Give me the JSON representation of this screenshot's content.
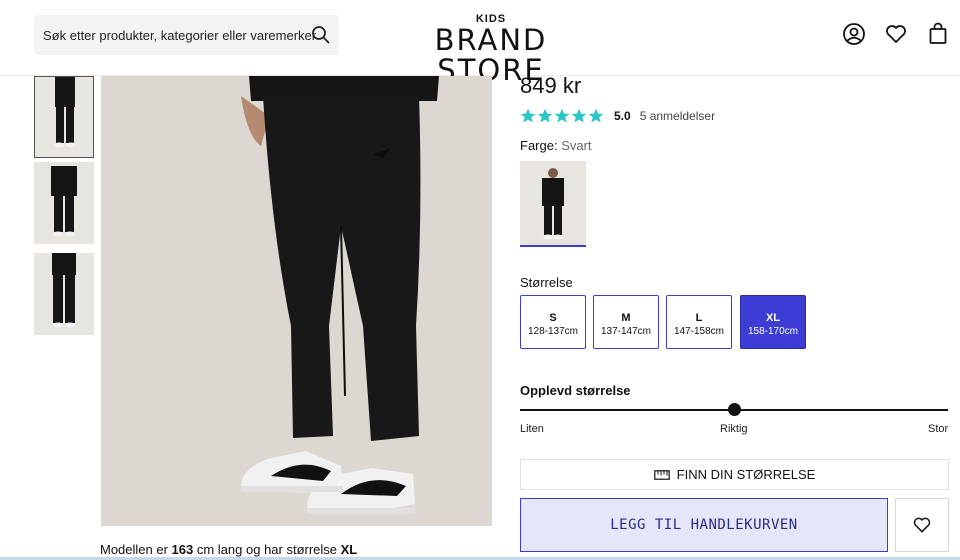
{
  "header": {
    "search_placeholder": "Søk etter produkter, kategorier eller varemerker",
    "logo_top": "KIDS",
    "logo_main": "BRAND STORE",
    "icons": [
      "account-icon",
      "wishlist-icon",
      "cart-icon"
    ]
  },
  "gallery": {
    "thumbnails": [
      "thumbnail-front",
      "thumbnail-full-outfit",
      "thumbnail-back"
    ],
    "selected_index": 0,
    "model_info": {
      "prefix": "Modellen er ",
      "height": "163",
      "middle": " cm lang og har størrelse ",
      "size": "XL"
    }
  },
  "product": {
    "price": "849 kr",
    "rating": {
      "value": "5.0",
      "stars": 5,
      "count_label": "5 anmeldelser",
      "star_color": "#2cc5c5"
    },
    "color_label": "Farge:",
    "color_value": "Svart",
    "size_label": "Størrelse",
    "sizes": [
      {
        "name": "S",
        "range": "128-137cm",
        "selected": false
      },
      {
        "name": "M",
        "range": "137-147cm",
        "selected": false
      },
      {
        "name": "L",
        "range": "147-158cm",
        "selected": false
      },
      {
        "name": "XL",
        "range": "158-170cm",
        "selected": true
      }
    ],
    "fit": {
      "title": "Opplevd størrelse",
      "labels": [
        "Liten",
        "Riktig",
        "Stor"
      ],
      "position": 0.5
    },
    "find_size_label": "FINN DIN STØRRELSE",
    "add_to_cart_label": "LEGG TIL HANDLEKURVEN"
  },
  "colors": {
    "accent": "#3d3dd6",
    "accent_light": "#e6e6fb",
    "star": "#2cc5c5"
  }
}
